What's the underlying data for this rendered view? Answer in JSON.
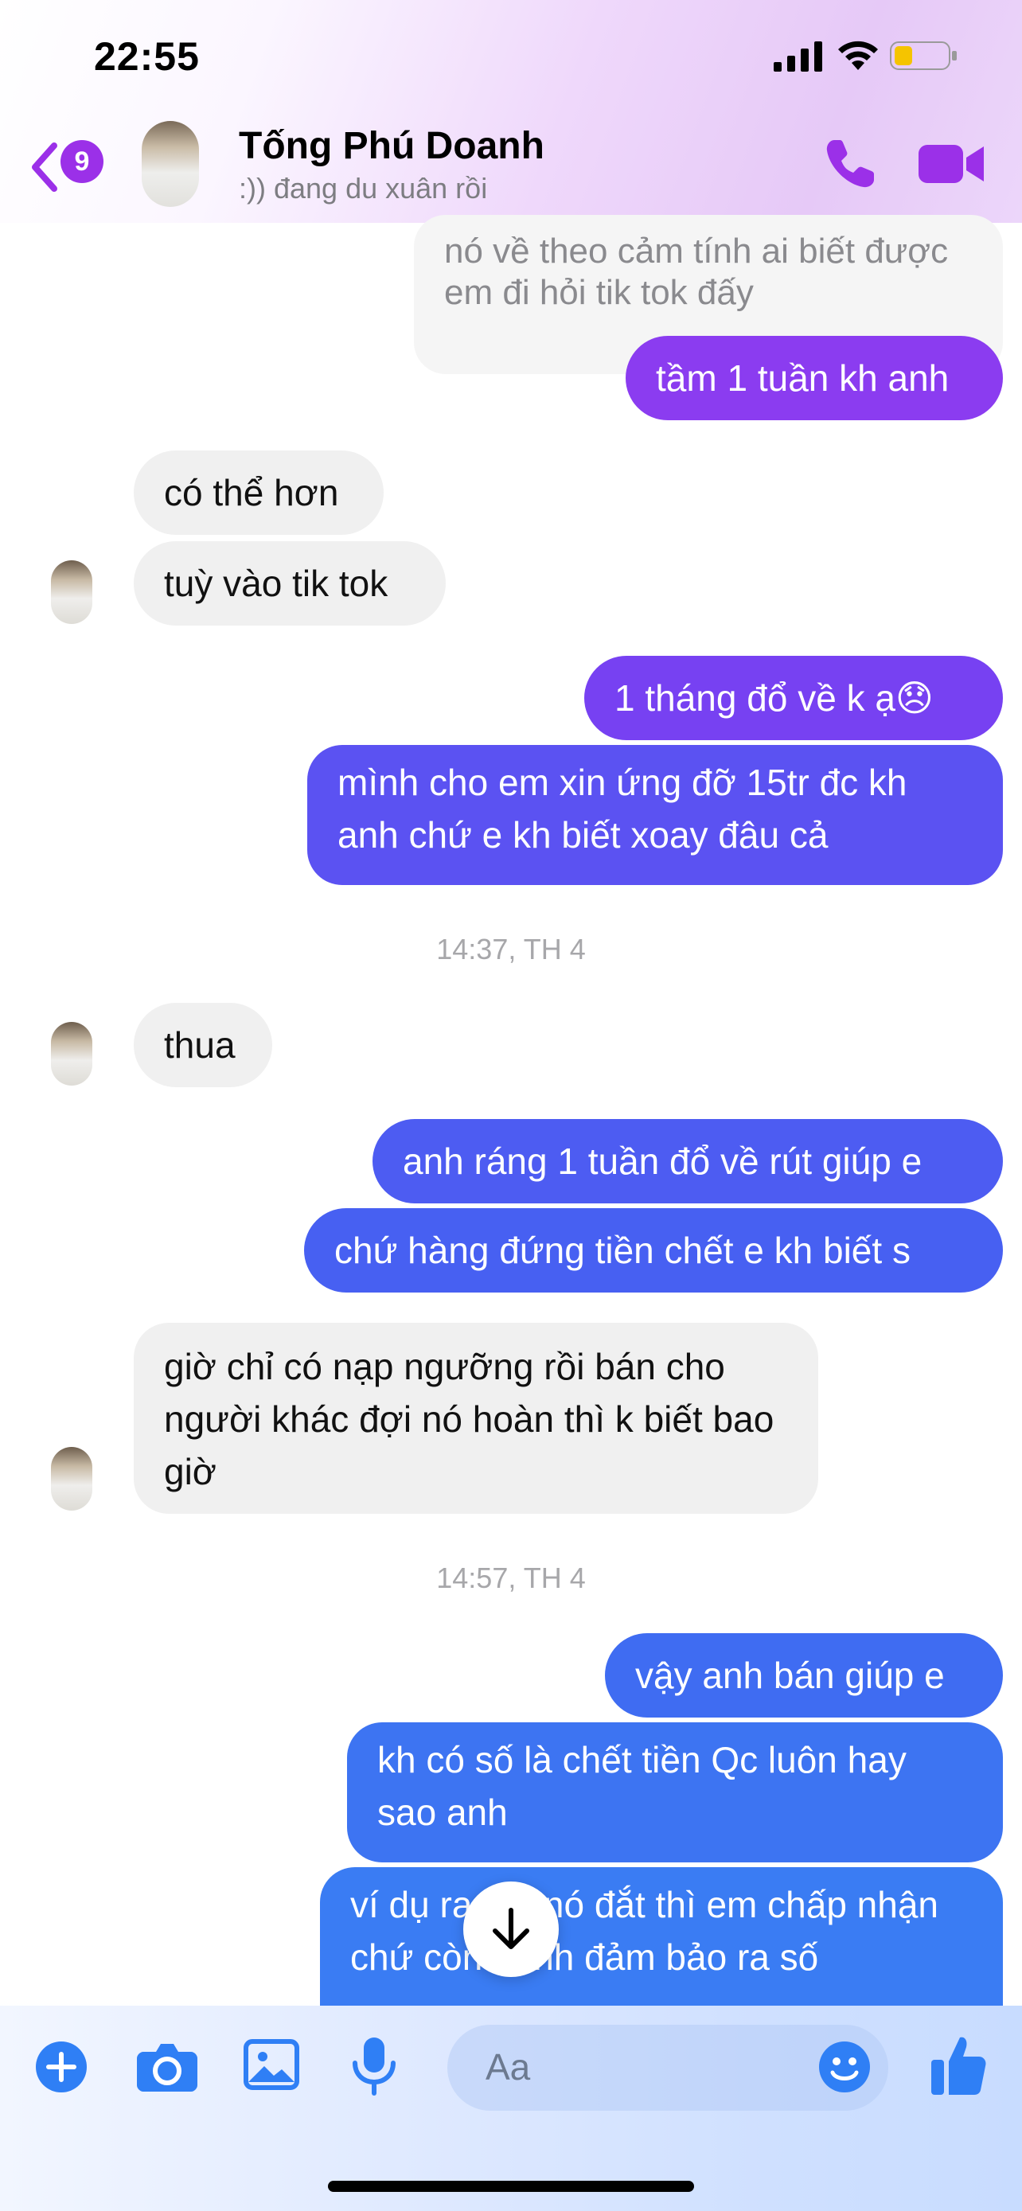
{
  "status_bar": {
    "time": "22:55"
  },
  "header": {
    "back_badge": "9",
    "contact_name": "Tống Phú Doanh",
    "contact_status": ":)) đang du xuân rồi"
  },
  "messages": [
    {
      "side": "sent-old",
      "text": "nó về theo cảm tính ai biết được em đi hỏi tik tok đấy"
    },
    {
      "side": "sent",
      "text": "tầm 1 tuần kh anh"
    },
    {
      "side": "received",
      "text": "có thể hơn"
    },
    {
      "side": "received",
      "text": "tuỳ vào tik tok"
    },
    {
      "side": "sent",
      "text": "1 tháng đổ về k ạ😞"
    },
    {
      "side": "sent",
      "text": "mình cho em xin ứng đỡ 15tr đc kh anh chứ e kh biết xoay đâu cả"
    },
    {
      "side": "timestamp",
      "text": "14:37, TH 4"
    },
    {
      "side": "received",
      "text": "thua"
    },
    {
      "side": "sent",
      "text": "anh ráng 1 tuần đổ về rút giúp e"
    },
    {
      "side": "sent",
      "text": "chứ hàng đứng tiền chết e kh biết s"
    },
    {
      "side": "received",
      "text": "giờ chỉ có nạp ngưỡng rồi bán cho người khác đợi nó hoàn thì k biết bao giờ"
    },
    {
      "side": "timestamp",
      "text": "14:57, TH 4"
    },
    {
      "side": "sent",
      "text": "vậy anh bán giúp e"
    },
    {
      "side": "sent",
      "text": "kh có số là chết tiền Qc luôn hay sao anh"
    },
    {
      "side": "sent",
      "text": "ví dụ ra mà nó đắt thì em chấp nhận chứ còn mình đảm bảo ra số"
    }
  ],
  "composer": {
    "placeholder": "Aa"
  },
  "colors": {
    "accent_purple": "#9b30e8",
    "sent_purple": "#8b3cf0",
    "sent_indigo": "#5b52f2",
    "sent_blue": "#3d74f2",
    "received_gray": "#f0f0f0",
    "composer_blue": "#2f7ff5"
  },
  "icons": [
    "back-chevron-icon",
    "phone-icon",
    "video-camera-icon",
    "plus-icon",
    "camera-icon",
    "image-icon",
    "microphone-icon",
    "emoji-icon",
    "thumbs-up-icon",
    "arrow-down-icon"
  ]
}
